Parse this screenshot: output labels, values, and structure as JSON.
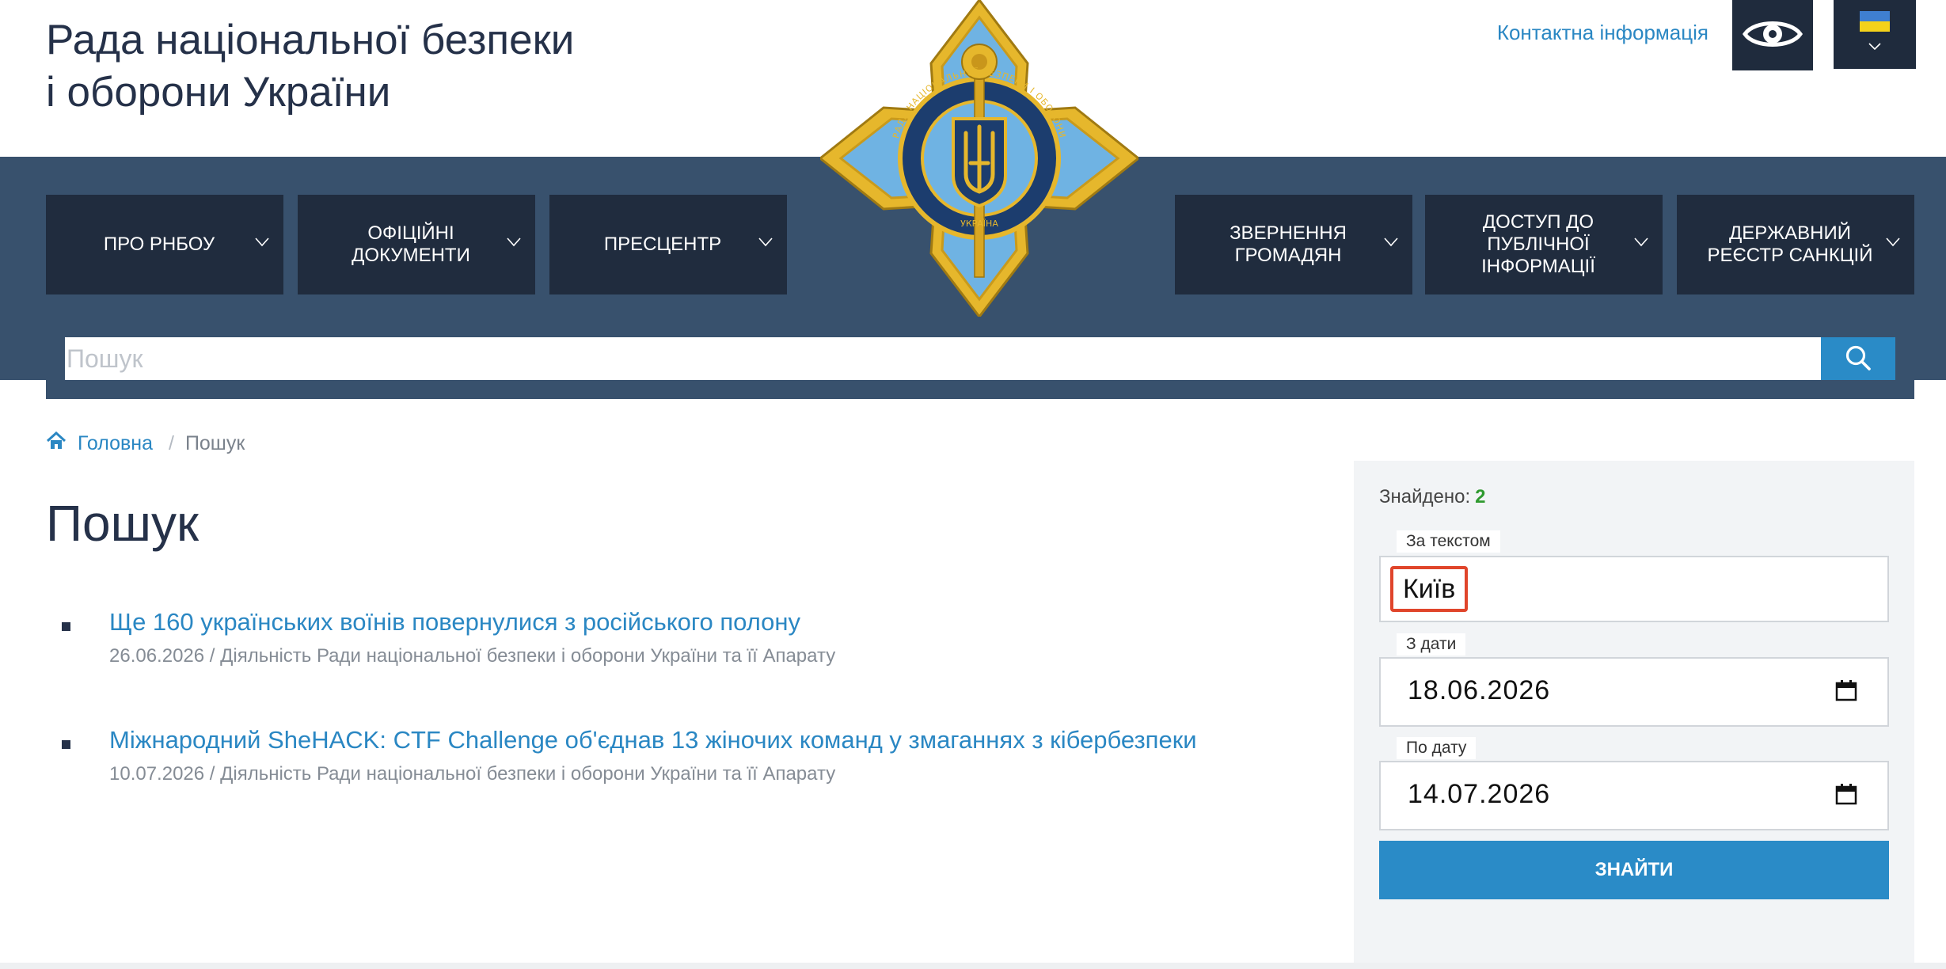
{
  "header": {
    "title_line1": "Рада національної безпеки",
    "title_line2": "і оборони України",
    "contact_link": "Контактна інформація",
    "accessibility_icon": "eye-icon",
    "language_flag": "ukraine-flag-icon",
    "emblem_text": "РАДА НАЦІОНАЛЬНОЇ БЕЗПЕКИ І ОБОРОНИ УКРАЇНА"
  },
  "nav": {
    "items": [
      {
        "label": "ПРО РНБОУ"
      },
      {
        "label": "ОФІЦІЙНІ ДОКУМЕНТИ"
      },
      {
        "label": "ПРЕСЦЕНТР"
      },
      {
        "label": "ЗВЕРНЕННЯ ГРОМАДЯН"
      },
      {
        "label": "ДОСТУП ДО ПУБЛІЧНОЇ ІНФОРМАЦІЇ"
      },
      {
        "label": "ДЕРЖАВНИЙ РЕЄСТР САНКЦІЙ"
      }
    ]
  },
  "search": {
    "placeholder": "Пошук",
    "value": ""
  },
  "breadcrumb": {
    "home": "Головна",
    "separator": "/",
    "current": "Пошук"
  },
  "page": {
    "title": "Пошук"
  },
  "results": [
    {
      "title": "Ще 160 українських воїнів повернулися з російського полону",
      "meta": "26.06.2026 / Діяльність Ради національної безпеки і оборони України та її Апарату"
    },
    {
      "title": "Міжнародний SheHACK: CTF Challenge об'єднав 13 жіночих команд у змаганнях з кібербезпеки",
      "meta": "10.07.2026 / Діяльність Ради національної безпеки і оборони України та її Апарату"
    }
  ],
  "filters": {
    "found_label": "Знайдено:",
    "found_count": "2",
    "text_label": "За текстом",
    "text_value": "Київ",
    "from_label": "З дати",
    "from_value": "18.06.2026",
    "to_label": "По дату",
    "to_value": "14.07.2026",
    "submit_label": "ЗНАЙТИ"
  },
  "colors": {
    "brand_dark": "#202c3e",
    "band": "#38516d",
    "accent_blue": "#2a8bc7",
    "link": "#2a87c3",
    "highlight": "#e0452b"
  }
}
